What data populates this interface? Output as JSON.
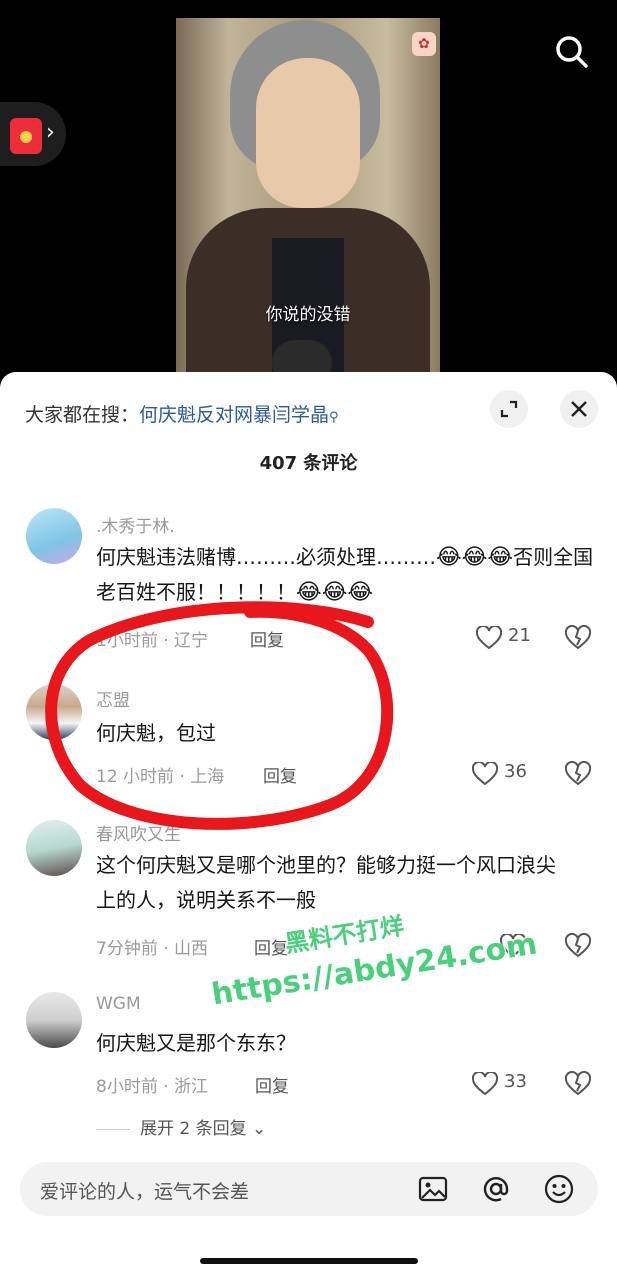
{
  "video": {
    "subtitle": "你说的没错"
  },
  "panel": {
    "hot_search_prefix": "大家都在搜：",
    "hot_search_keyword": "何庆魁反对网暴闫学晶",
    "comment_count": "407 条评论"
  },
  "comments": [
    {
      "username": ".木秀于林.",
      "text_before": "何庆魁违法赌博………必须处理………",
      "text_after": "否则全国老百姓不服！！！！！",
      "time": "1小时前 · 辽宁",
      "reply": "回复",
      "likes": "21"
    },
    {
      "username": "忑盟",
      "text": "何庆魁，包过",
      "time": "12 小时前 · 上海",
      "reply": "回复",
      "likes": "36"
    },
    {
      "username": "春风吹又生",
      "text": "这个何庆魁又是哪个池里的？能够力挺一个风口浪尖上的人，说明关系不一般",
      "time": "7分钟前 · 山西",
      "reply": "回复",
      "likes": ""
    },
    {
      "username": "WGM",
      "text": "何庆魁又是那个东东？",
      "time": "8小时前 · 浙江",
      "reply": "回复",
      "likes": "33"
    }
  ],
  "expand_replies": "展开 2 条回复",
  "input": {
    "placeholder": "爱评论的人，运气不会差"
  },
  "watermark": {
    "line1": "黑料不打烊",
    "line2": "https://abdy24.com"
  },
  "colors": {
    "keyword": "#2b5b9a",
    "annotation": "#e8171b",
    "watermark": "#4ad07c"
  },
  "icons": [
    "search-icon",
    "red-packet-icon",
    "expand-icon",
    "close-icon",
    "heart-icon",
    "broken-heart-icon",
    "image-icon",
    "at-icon",
    "emoji-icon"
  ]
}
